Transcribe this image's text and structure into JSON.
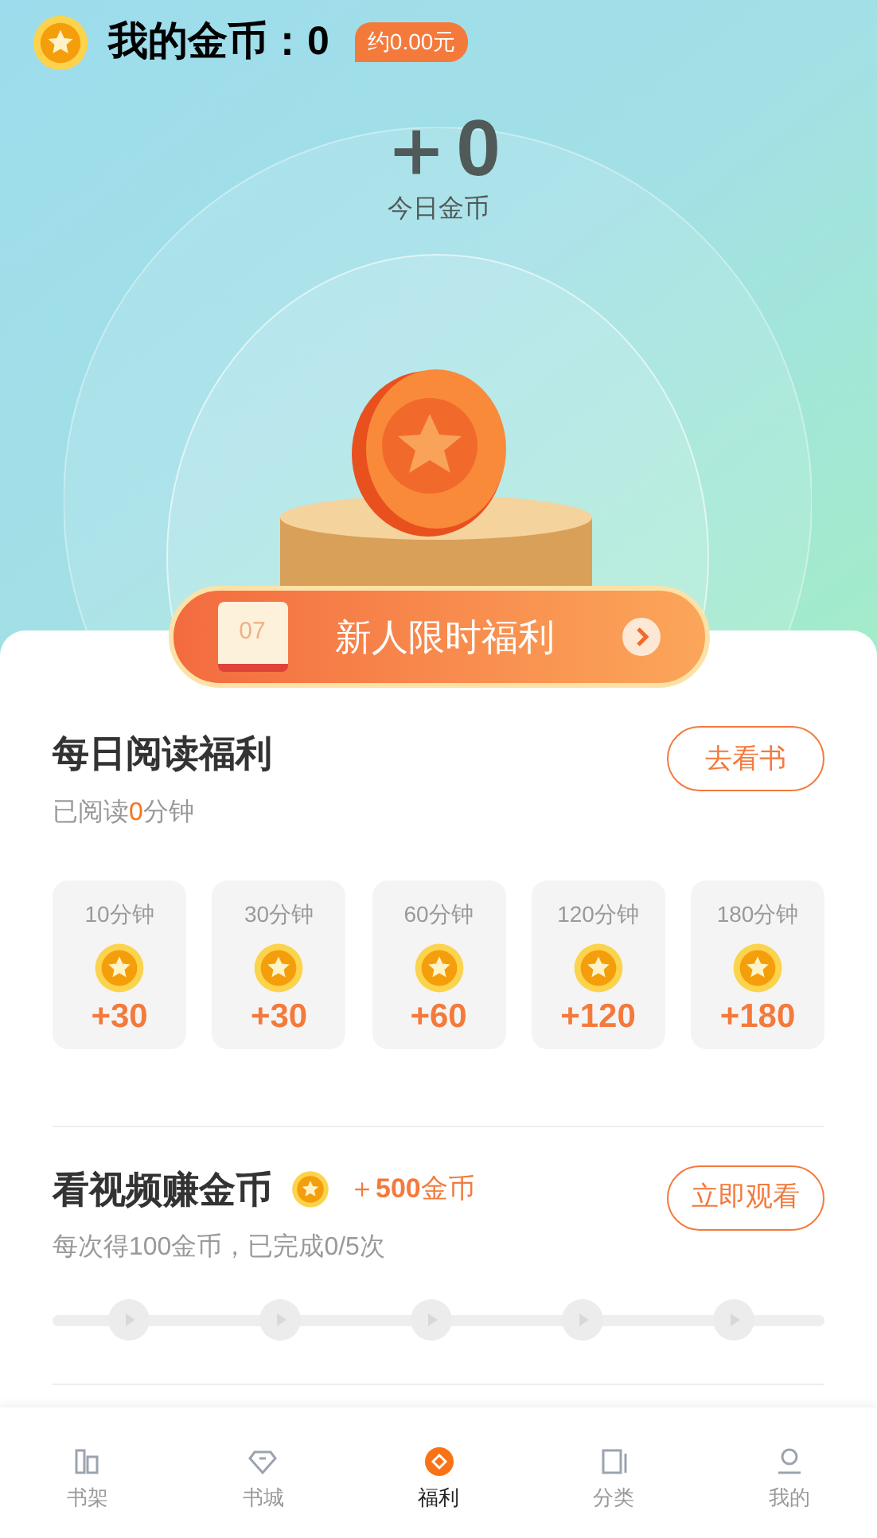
{
  "header": {
    "title": "我的金币：",
    "balance": "0",
    "cash_badge": "约0.00元"
  },
  "today": {
    "amount": "＋0",
    "label": "今日金币"
  },
  "promo_banner": {
    "calendar_text": "07",
    "label": "新人限时福利"
  },
  "daily_reading": {
    "title": "每日阅读福利",
    "progress": "已阅读**0**分钟",
    "progress_value_highlighted": true,
    "button": "去看书",
    "rewards": [
      {
        "duration": "10分钟",
        "reward": "+30"
      },
      {
        "duration": "30分钟",
        "reward": "+30"
      },
      {
        "duration": "60分钟",
        "reward": "+60"
      },
      {
        "duration": "120分钟",
        "reward": "+120"
      },
      {
        "duration": "180分钟",
        "reward": "+180"
      }
    ]
  },
  "video_task": {
    "title": "看视频赚金币",
    "bonus_prefix": "＋",
    "bonus_amount": "500",
    "bonus_unit": "金币",
    "description": "每次得100金币，已完成0/5次",
    "button": "立即观看",
    "steps": [
      {
        "done": false
      },
      {
        "done": false
      },
      {
        "done": false
      },
      {
        "done": false
      },
      {
        "done": false
      }
    ]
  },
  "tab_bar": [
    {
      "label": "书架",
      "kind": "shelf",
      "selected": false
    },
    {
      "label": "书城",
      "kind": "store",
      "selected": false
    },
    {
      "label": "福利",
      "kind": "welfare",
      "selected": true
    },
    {
      "label": "分类",
      "kind": "category",
      "selected": false
    },
    {
      "label": "我的",
      "kind": "profile",
      "selected": false
    }
  ]
}
